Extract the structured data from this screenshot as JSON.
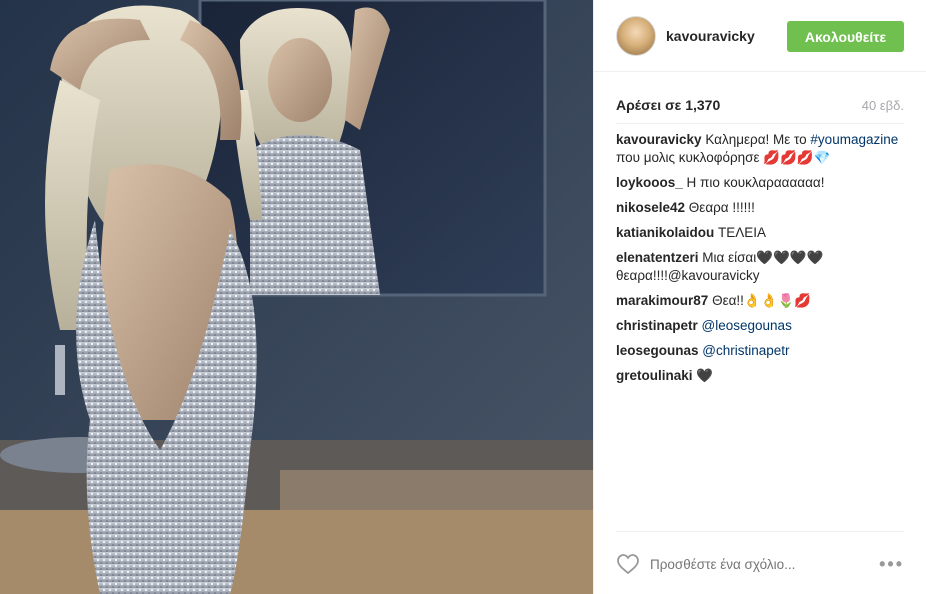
{
  "post": {
    "username": "kavouravicky",
    "follow_label": "Ακολουθείτε",
    "likes_text": "Αρέσει σε 1,370",
    "time_text": "40 εβδ.",
    "comment_placeholder": "Προσθέστε ένα σχόλιο...",
    "more_label": "•••"
  },
  "comments": [
    {
      "user": "kavouravicky",
      "text_before": " Καλημερα! Με το ",
      "tag": "#youmagazine",
      "text_after": " που μολις κυκλοφόρησε 💋💋💋💎"
    },
    {
      "user": "loykooos_",
      "text_before": " Η πιο κουκλαραααααα!",
      "tag": "",
      "text_after": ""
    },
    {
      "user": "nikosele42",
      "text_before": " Θεαρα !!!!!!",
      "tag": "",
      "text_after": ""
    },
    {
      "user": "katianikolaidou",
      "text_before": " ΤΕΛΕΙΑ",
      "tag": "",
      "text_after": ""
    },
    {
      "user": "elenatentzeri",
      "text_before": " Μια είσαι🖤🖤🖤🖤θεαρα!!!!@kavouravicky",
      "tag": "",
      "text_after": ""
    },
    {
      "user": "marakimour87",
      "text_before": " Θεα!!👌👌🌷💋",
      "tag": "",
      "text_after": ""
    },
    {
      "user": "christinapetr",
      "text_before": " ",
      "tag": "@leosegounas",
      "text_after": ""
    },
    {
      "user": "leosegounas",
      "text_before": " ",
      "tag": "@christinapetr",
      "text_after": ""
    },
    {
      "user": "gretoulinaki",
      "text_before": " 🖤",
      "tag": "",
      "text_after": ""
    }
  ],
  "colors": {
    "follow_bg": "#70c050",
    "tag": "#003569",
    "muted": "#a5a7aa"
  },
  "icons": {
    "like": "heart-outline-icon",
    "more": "ellipsis-icon"
  }
}
